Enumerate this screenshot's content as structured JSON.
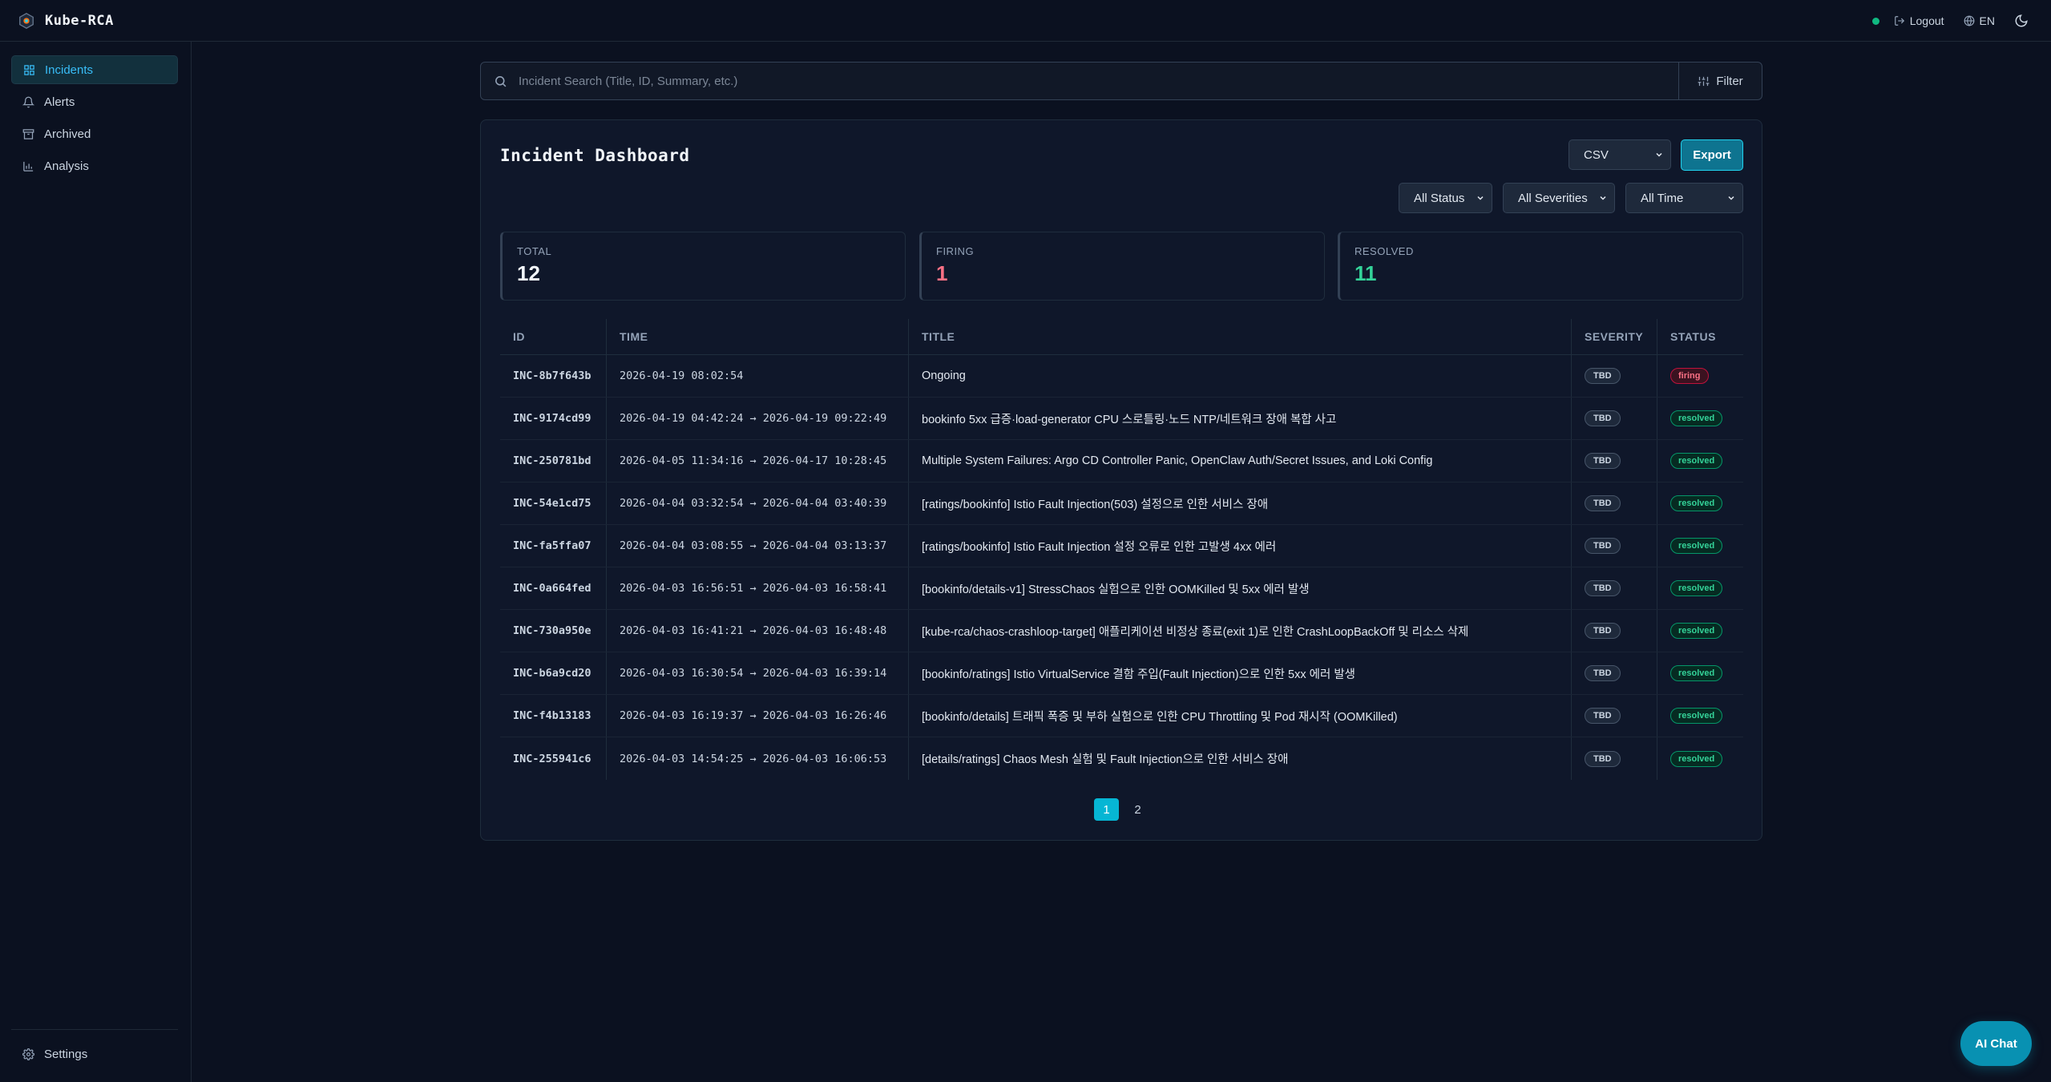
{
  "app": {
    "title": "Kube-RCA"
  },
  "topbar": {
    "logout_label": "Logout",
    "language_label": "EN"
  },
  "sidebar": {
    "items": [
      {
        "label": "Incidents",
        "icon": "dashboard-icon",
        "active": true
      },
      {
        "label": "Alerts",
        "icon": "bell-icon",
        "active": false
      },
      {
        "label": "Archived",
        "icon": "archive-icon",
        "active": false
      },
      {
        "label": "Analysis",
        "icon": "bar-chart-icon",
        "active": false
      }
    ],
    "settings_label": "Settings"
  },
  "search": {
    "placeholder": "Incident Search (Title, ID, Summary, etc.)",
    "filter_label": "Filter"
  },
  "dashboard": {
    "title": "Incident Dashboard",
    "export_format": "CSV",
    "export_label": "Export",
    "filters": {
      "status": "All Status",
      "severity": "All Severities",
      "time": "All Time"
    },
    "stats": {
      "total_label": "TOTAL",
      "total_value": "12",
      "firing_label": "FIRING",
      "firing_value": "1",
      "resolved_label": "RESOLVED",
      "resolved_value": "11"
    },
    "columns": {
      "id": "ID",
      "time": "TIME",
      "title": "TITLE",
      "severity": "SEVERITY",
      "status": "STATUS"
    },
    "rows": [
      {
        "id": "INC-8b7f643b",
        "time": "2026-04-19 08:02:54",
        "title": "Ongoing",
        "severity": "TBD",
        "status": "firing"
      },
      {
        "id": "INC-9174cd99",
        "time": "2026-04-19 04:42:24 → 2026-04-19 09:22:49",
        "title": "bookinfo 5xx 급증·load-generator CPU 스로틀링·노드 NTP/네트워크 장애 복합 사고",
        "severity": "TBD",
        "status": "resolved"
      },
      {
        "id": "INC-250781bd",
        "time": "2026-04-05 11:34:16 → 2026-04-17 10:28:45",
        "title": "Multiple System Failures: Argo CD Controller Panic, OpenClaw Auth/Secret Issues, and Loki Config",
        "severity": "TBD",
        "status": "resolved"
      },
      {
        "id": "INC-54e1cd75",
        "time": "2026-04-04 03:32:54 → 2026-04-04 03:40:39",
        "title": "[ratings/bookinfo] Istio Fault Injection(503) 설정으로 인한 서비스 장애",
        "severity": "TBD",
        "status": "resolved"
      },
      {
        "id": "INC-fa5ffa07",
        "time": "2026-04-04 03:08:55 → 2026-04-04 03:13:37",
        "title": "[ratings/bookinfo] Istio Fault Injection 설정 오류로 인한 고발생 4xx 에러",
        "severity": "TBD",
        "status": "resolved"
      },
      {
        "id": "INC-0a664fed",
        "time": "2026-04-03 16:56:51 → 2026-04-03 16:58:41",
        "title": "[bookinfo/details-v1] StressChaos 실험으로 인한 OOMKilled 및 5xx 에러 발생",
        "severity": "TBD",
        "status": "resolved"
      },
      {
        "id": "INC-730a950e",
        "time": "2026-04-03 16:41:21 → 2026-04-03 16:48:48",
        "title": "[kube-rca/chaos-crashloop-target] 애플리케이션 비정상 종료(exit 1)로 인한 CrashLoopBackOff 및 리소스 삭제",
        "severity": "TBD",
        "status": "resolved"
      },
      {
        "id": "INC-b6a9cd20",
        "time": "2026-04-03 16:30:54 → 2026-04-03 16:39:14",
        "title": "[bookinfo/ratings] Istio VirtualService 결함 주입(Fault Injection)으로 인한 5xx 에러 발생",
        "severity": "TBD",
        "status": "resolved"
      },
      {
        "id": "INC-f4b13183",
        "time": "2026-04-03 16:19:37 → 2026-04-03 16:26:46",
        "title": "[bookinfo/details] 트래픽 폭증 및 부하 실험으로 인한 CPU Throttling 및 Pod 재시작 (OOMKilled)",
        "severity": "TBD",
        "status": "resolved"
      },
      {
        "id": "INC-255941c6",
        "time": "2026-04-03 14:54:25 → 2026-04-03 16:06:53",
        "title": "[details/ratings] Chaos Mesh 실험 및 Fault Injection으로 인한 서비스 장애",
        "severity": "TBD",
        "status": "resolved"
      }
    ],
    "pagination": {
      "pages": [
        "1",
        "2"
      ],
      "current": "1"
    }
  },
  "ai_chat_label": "AI Chat",
  "colors": {
    "accent": "#06b6d4",
    "firing": "#fb7185",
    "resolved": "#34d399",
    "background": "#0b1120"
  }
}
